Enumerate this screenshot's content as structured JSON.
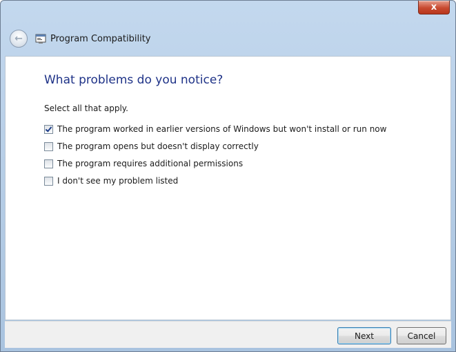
{
  "window": {
    "title": "Program Compatibility",
    "close_label": "x"
  },
  "nav": {
    "back_icon": "back-arrow-icon",
    "app_icon": "program-compatibility-icon"
  },
  "page": {
    "heading": "What problems do you notice?",
    "instruction": "Select all that apply."
  },
  "options": [
    {
      "label": "The program worked in earlier versions of Windows but won't install or run now",
      "checked": true
    },
    {
      "label": "The program opens but doesn't display correctly",
      "checked": false
    },
    {
      "label": "The program requires additional permissions",
      "checked": false
    },
    {
      "label": "I don't see my problem listed",
      "checked": false
    }
  ],
  "footer": {
    "next_label": "Next",
    "cancel_label": "Cancel"
  },
  "colors": {
    "heading": "#1e3287",
    "close_button": "#c84a30"
  }
}
